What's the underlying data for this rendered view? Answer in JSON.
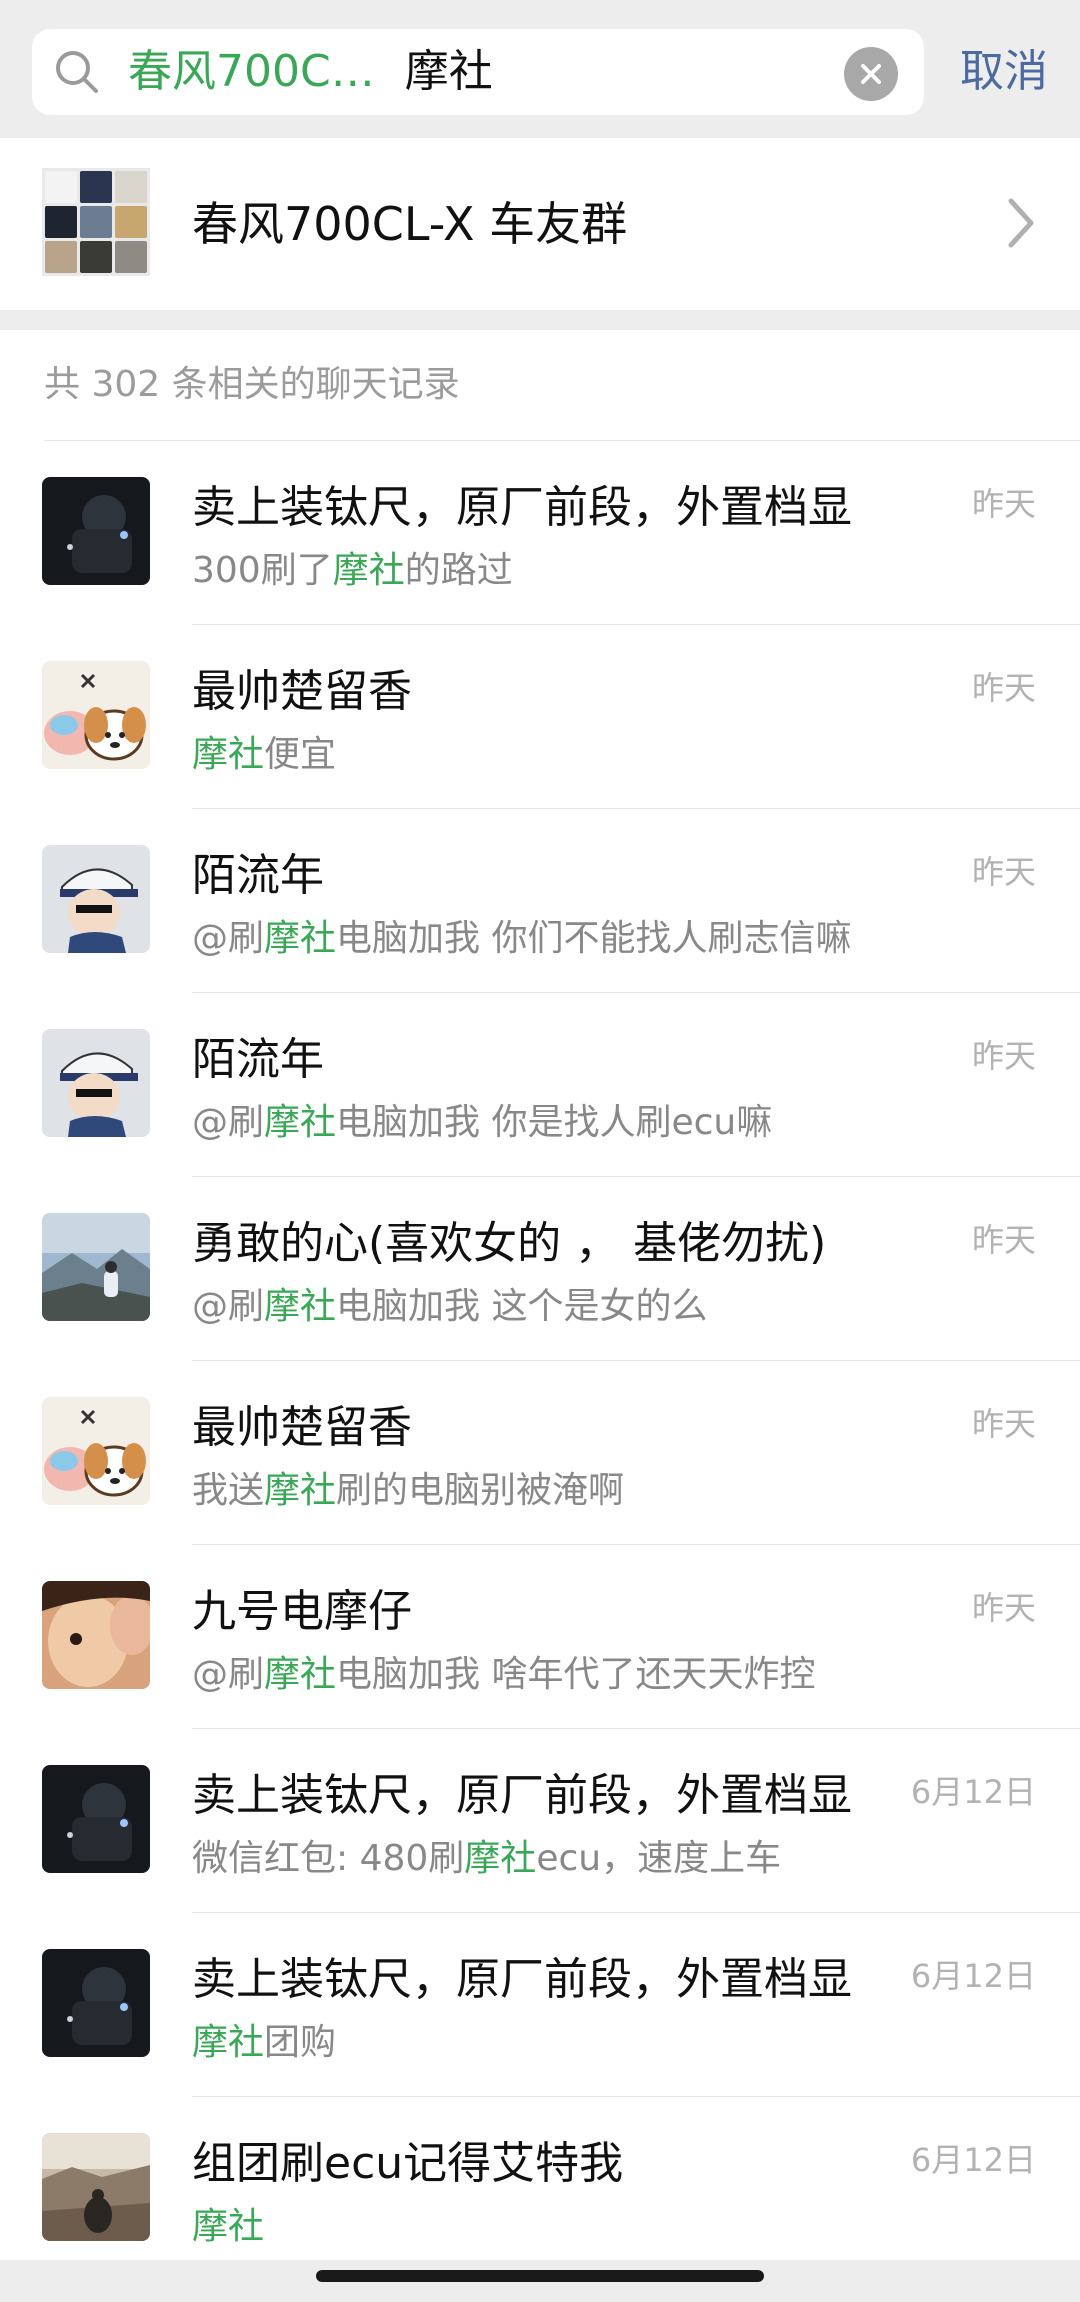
{
  "search": {
    "tag": "春风700C…",
    "query": "摩社",
    "cancel": "取消"
  },
  "group": {
    "name": "春风700CL-X 车友群"
  },
  "records_header": "共 302 条相关的聊天记录",
  "highlight": "摩社",
  "records": [
    {
      "name": "卖上装钛尺，原厂前段，外置档显",
      "pre": "300刷了",
      "post": "的路过",
      "time": "昨天",
      "avatar": "night-rider"
    },
    {
      "name": "最帅楚留香",
      "pre": "",
      "post": "便宜",
      "time": "昨天",
      "avatar": "cartoon-dog"
    },
    {
      "name": "陌流年",
      "pre": "@刷",
      "post": "电脑加我 你们不能找人刷志信嘛",
      "time": "昨天",
      "avatar": "anime-boy-cap"
    },
    {
      "name": "陌流年",
      "pre": "@刷",
      "post": "电脑加我 你是找人刷ecu嘛",
      "time": "昨天",
      "avatar": "anime-boy-cap"
    },
    {
      "name": "勇敢的心(喜欢女的 ， 基佬勿扰)",
      "pre": "@刷",
      "post": "电脑加我 这个是女的么",
      "time": "昨天",
      "avatar": "mountain-view"
    },
    {
      "name": "最帅楚留香",
      "pre": "我送",
      "post": "刷的电脑别被淹啊",
      "time": "昨天",
      "avatar": "cartoon-dog"
    },
    {
      "name": "九号电摩仔",
      "pre": "@刷",
      "post": "电脑加我 啥年代了还天天炸控",
      "time": "昨天",
      "avatar": "face-photo"
    },
    {
      "name": "卖上装钛尺，原厂前段，外置档显",
      "pre": "微信红包: 480刷",
      "post": "ecu，速度上车",
      "time": "6月12日",
      "avatar": "night-rider"
    },
    {
      "name": "卖上装钛尺，原厂前段，外置档显",
      "pre": "",
      "post": "团购",
      "time": "6月12日",
      "avatar": "night-rider"
    },
    {
      "name": "组团刷ecu记得艾特我",
      "pre": "",
      "post": "",
      "time": "6月12日",
      "avatar": "desert-rider"
    }
  ]
}
